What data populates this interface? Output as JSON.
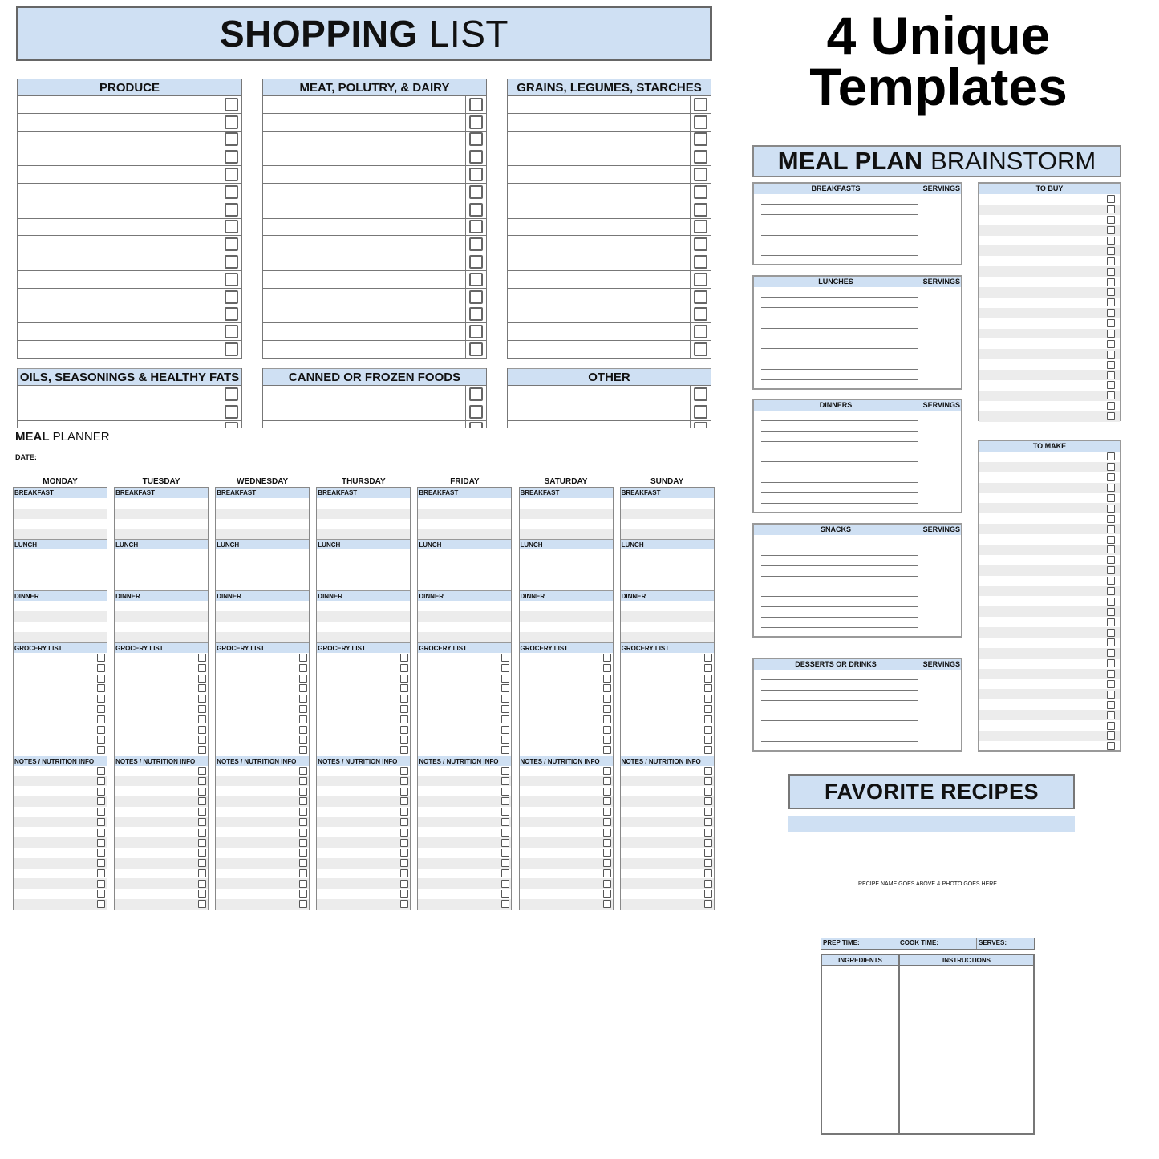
{
  "promo": {
    "line1": "4 Unique",
    "line2": "Templates"
  },
  "shopping_list": {
    "title_bold": "SHOPPING",
    "title_light": "LIST",
    "sections_top": [
      {
        "title": "PRODUCE",
        "rows": 15
      },
      {
        "title": "MEAT, POLUTRY, & DAIRY",
        "rows": 15
      },
      {
        "title": "GRAINS, LEGUMES, STARCHES",
        "rows": 15
      }
    ],
    "sections_bottom": [
      {
        "title": "OILS, SEASONINGS & HEALTHY FATS",
        "rows": 3
      },
      {
        "title": "CANNED OR FROZEN FOODS",
        "rows": 3
      },
      {
        "title": "OTHER",
        "rows": 3
      }
    ]
  },
  "meal_planner": {
    "title_bold": "MEAL",
    "title_light": "PLANNER",
    "date_label": "DATE:",
    "days": [
      "MONDAY",
      "TUESDAY",
      "WEDNESDAY",
      "THURSDAY",
      "FRIDAY",
      "SATURDAY",
      "SUNDAY"
    ],
    "sections": [
      {
        "label": "BREAKFAST",
        "rows": 4,
        "checkboxes": false
      },
      {
        "label": "LUNCH",
        "rows": 4,
        "checkboxes": false
      },
      {
        "label": "DINNER",
        "rows": 4,
        "checkboxes": false
      },
      {
        "label": "GROCERY LIST",
        "rows": 10,
        "checkboxes": true
      },
      {
        "label": "NOTES / NUTRITION INFO",
        "rows": 14,
        "checkboxes": true
      }
    ]
  },
  "brainstorm": {
    "title_bold": "MEAL PLAN",
    "title_light": "BRAINSTORM",
    "servings_label": "SERVINGS",
    "categories": [
      {
        "label": "BREAKFASTS",
        "lines": 6
      },
      {
        "label": "LUNCHES",
        "lines": 9
      },
      {
        "label": "DINNERS",
        "lines": 9
      },
      {
        "label": "SNACKS",
        "lines": 9
      },
      {
        "label": "DESSERTS OR DRINKS",
        "lines": 7
      }
    ],
    "to_buy": {
      "label": "TO BUY",
      "rows": 22
    },
    "to_make": {
      "label": "TO MAKE",
      "rows": 29
    }
  },
  "favorite_recipes": {
    "title": "FAVORITE RECIPES",
    "photo_note": "RECIPE NAME GOES ABOVE & PHOTO GOES HERE",
    "prep_time_label": "PREP TIME:",
    "cook_time_label": "COOK TIME:",
    "serves_label": "SERVES:",
    "ingredients_label": "INGREDIENTS",
    "instructions_label": "INSTRUCTIONS"
  }
}
